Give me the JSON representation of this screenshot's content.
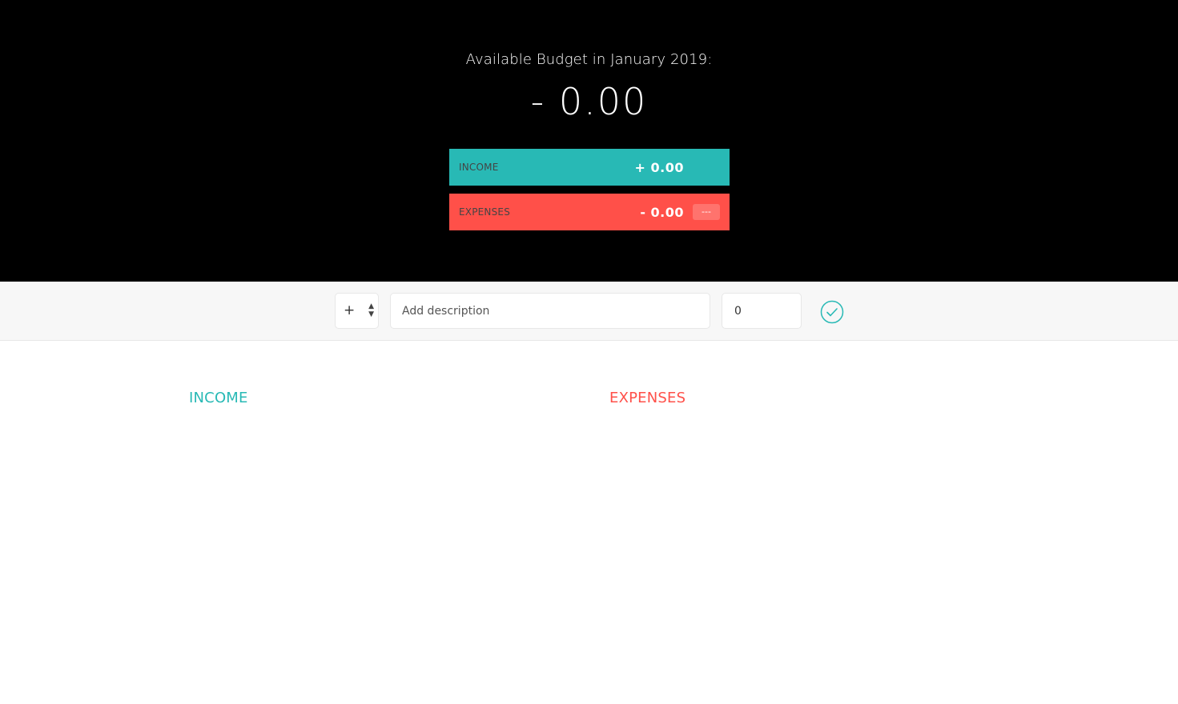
{
  "budget": {
    "title": "Available Budget in January 2019:",
    "value": "- 0.00",
    "income": {
      "label": "INCOME",
      "value": "+ 0.00"
    },
    "expenses": {
      "label": "EXPENSES",
      "value": "- 0.00",
      "percentage": "---"
    }
  },
  "add": {
    "type_value": "+",
    "type_arrows": "▲▼",
    "description_placeholder": "Add description",
    "value": "0",
    "submit_icon": "check-circle-icon"
  },
  "lists": {
    "income_title": "INCOME",
    "expenses_title": "EXPENSES"
  },
  "colors": {
    "income": "#28b9b5",
    "expenses": "#ff5049",
    "header_bg": "#000000"
  }
}
